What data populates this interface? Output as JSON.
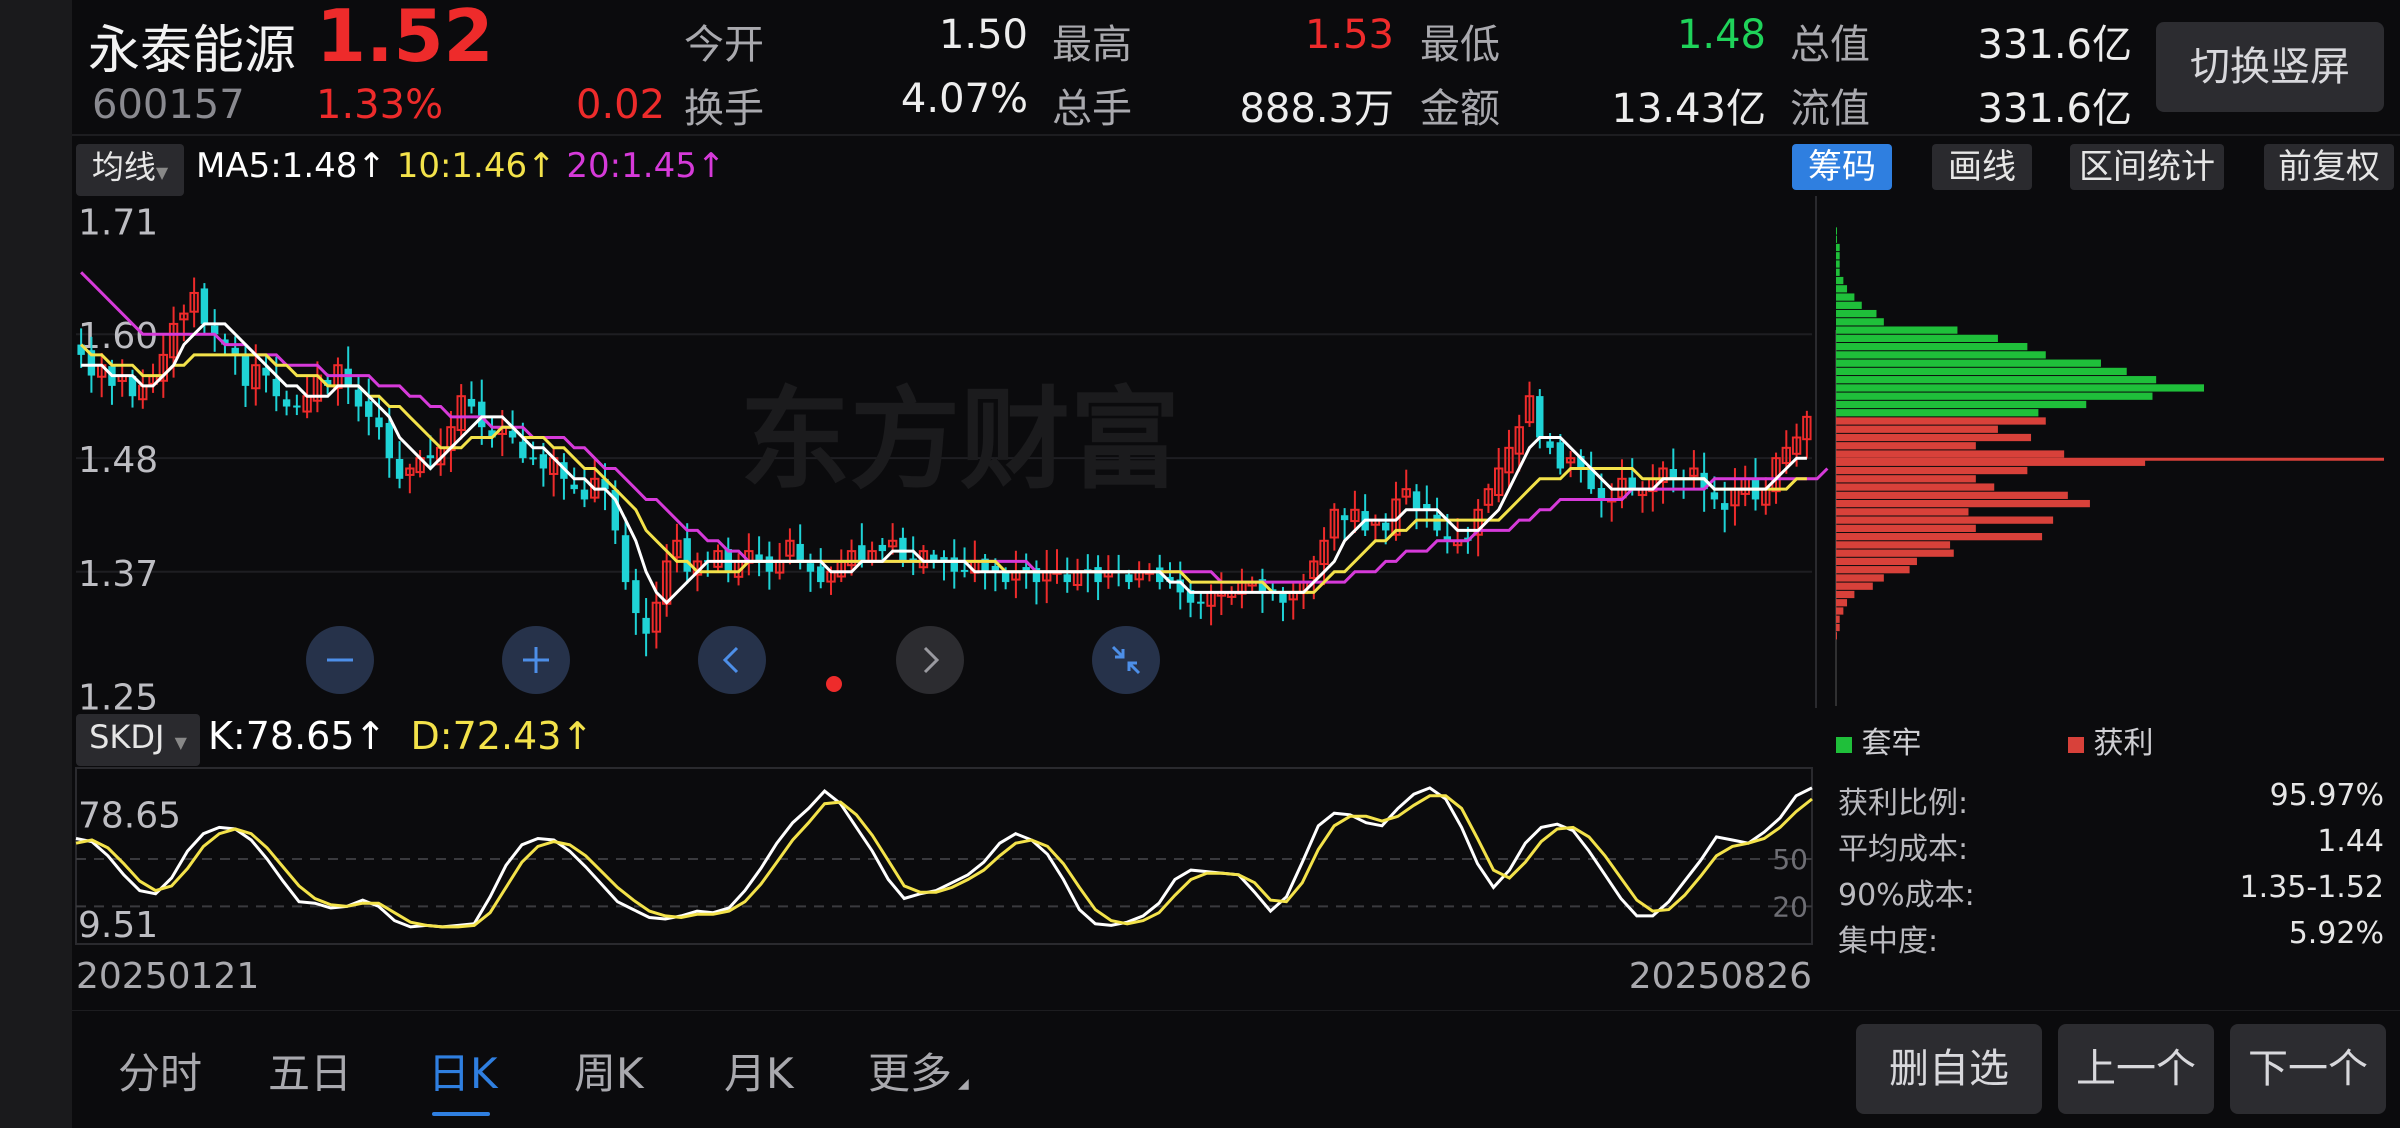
{
  "header": {
    "name": "永泰能源",
    "price": "1.52",
    "code": "600157",
    "change_pct": "1.33%",
    "change": "0.02",
    "stats": [
      {
        "label": "今开",
        "value": "1.50",
        "color": "white"
      },
      {
        "label": "最高",
        "value": "1.53",
        "color": "red"
      },
      {
        "label": "最低",
        "value": "1.48",
        "color": "green"
      },
      {
        "label": "总值",
        "value": "331.6亿",
        "color": "white"
      },
      {
        "label": "换手",
        "value": "4.07%",
        "color": "white"
      },
      {
        "label": "总手",
        "value": "888.3万",
        "color": "white"
      },
      {
        "label": "金额",
        "value": "13.43亿",
        "color": "white"
      },
      {
        "label": "流值",
        "value": "331.6亿",
        "color": "white"
      }
    ],
    "switch_button": "切换竖屏"
  },
  "ma_bar": {
    "selector": "均线",
    "ma5": "MA5:1.48↑",
    "ma10": "10:1.46↑",
    "ma20": "20:1.45↑",
    "buttons": [
      "筹码",
      "画线",
      "区间统计",
      "前复权"
    ]
  },
  "kdj_bar": {
    "selector": "SKDJ",
    "k": "K:78.65↑",
    "d": "D:72.43↑"
  },
  "watermark": "东方财富",
  "colors": {
    "up": "#ee2b2b",
    "down": "#1fd3d6",
    "ma5": "#ffffff",
    "ma10": "#f3e24a",
    "ma20": "#d63ad9",
    "accent": "#2f7fe0",
    "chip_loss": "#1fbf3a",
    "chip_profit": "#d8413a"
  },
  "dates": {
    "start": "20250121",
    "end": "20250826"
  },
  "controls": [
    "zoom-out-icon",
    "zoom-in-icon",
    "chevron-left-icon",
    "chevron-right-icon",
    "collapse-icon"
  ],
  "chip_panel": {
    "legend_loss": "套牢",
    "legend_profit": "获利",
    "stats": [
      {
        "label": "获利比例:",
        "value": "95.97%"
      },
      {
        "label": "平均成本:",
        "value": "1.44"
      },
      {
        "label": "90%成本:",
        "value": "1.35-1.52"
      },
      {
        "label": "集中度:",
        "value": "5.92%"
      }
    ],
    "price_min": 1.24,
    "price_max": 1.73,
    "current_price": 1.52,
    "bars": [
      [
        1.7,
        0.0
      ],
      [
        1.692,
        0.0
      ],
      [
        1.684,
        0.01
      ],
      [
        1.676,
        0.01
      ],
      [
        1.668,
        0.01
      ],
      [
        1.66,
        0.01
      ],
      [
        1.652,
        0.02
      ],
      [
        1.644,
        0.03
      ],
      [
        1.636,
        0.05
      ],
      [
        1.628,
        0.07
      ],
      [
        1.62,
        0.11
      ],
      [
        1.612,
        0.13
      ],
      [
        1.604,
        0.33
      ],
      [
        1.596,
        0.44
      ],
      [
        1.588,
        0.52
      ],
      [
        1.58,
        0.57
      ],
      [
        1.572,
        0.72
      ],
      [
        1.564,
        0.79
      ],
      [
        1.556,
        0.87
      ],
      [
        1.548,
        1.0
      ],
      [
        1.54,
        0.86
      ],
      [
        1.532,
        0.68
      ],
      [
        1.524,
        0.55
      ],
      [
        1.516,
        0.57
      ],
      [
        1.508,
        0.44
      ],
      [
        1.5,
        0.53
      ],
      [
        1.492,
        0.38
      ],
      [
        1.484,
        0.62
      ],
      [
        1.476,
        0.84
      ],
      [
        1.468,
        0.52
      ],
      [
        1.46,
        0.38
      ],
      [
        1.452,
        0.43
      ],
      [
        1.444,
        0.63
      ],
      [
        1.436,
        0.69
      ],
      [
        1.428,
        0.36
      ],
      [
        1.42,
        0.59
      ],
      [
        1.412,
        0.38
      ],
      [
        1.404,
        0.56
      ],
      [
        1.396,
        0.31
      ],
      [
        1.388,
        0.32
      ],
      [
        1.38,
        0.22
      ],
      [
        1.372,
        0.2
      ],
      [
        1.364,
        0.13
      ],
      [
        1.356,
        0.1
      ],
      [
        1.348,
        0.05
      ],
      [
        1.34,
        0.03
      ],
      [
        1.332,
        0.02
      ],
      [
        1.324,
        0.01
      ],
      [
        1.316,
        0.01
      ],
      [
        1.308,
        0.0
      ]
    ]
  },
  "bottom_nav": {
    "tabs": [
      "分时",
      "五日",
      "日K",
      "周K",
      "月K",
      "更多"
    ],
    "active": 2,
    "buttons": [
      "删自选",
      "上一个",
      "下一个"
    ]
  },
  "chart_data": [
    {
      "type": "candlestick",
      "name": "日K",
      "x_start": "20250121",
      "x_end": "20250826",
      "y_ticks": [
        1.71,
        1.6,
        1.48,
        1.37,
        1.25
      ],
      "ylim": [
        1.24,
        1.73
      ],
      "close": [
        1.58,
        1.56,
        1.57,
        1.55,
        1.56,
        1.54,
        1.55,
        1.56,
        1.58,
        1.61,
        1.62,
        1.64,
        1.61,
        1.6,
        1.59,
        1.58,
        1.55,
        1.57,
        1.56,
        1.54,
        1.53,
        1.53,
        1.54,
        1.56,
        1.55,
        1.57,
        1.55,
        1.53,
        1.52,
        1.51,
        1.48,
        1.46,
        1.47,
        1.48,
        1.48,
        1.49,
        1.51,
        1.54,
        1.53,
        1.51,
        1.5,
        1.51,
        1.5,
        1.48,
        1.48,
        1.47,
        1.48,
        1.46,
        1.45,
        1.44,
        1.46,
        1.45,
        1.41,
        1.36,
        1.33,
        1.31,
        1.34,
        1.38,
        1.4,
        1.37,
        1.38,
        1.38,
        1.39,
        1.37,
        1.38,
        1.39,
        1.38,
        1.37,
        1.38,
        1.4,
        1.38,
        1.37,
        1.36,
        1.37,
        1.38,
        1.39,
        1.38,
        1.39,
        1.39,
        1.4,
        1.38,
        1.38,
        1.39,
        1.38,
        1.38,
        1.37,
        1.37,
        1.38,
        1.37,
        1.37,
        1.36,
        1.37,
        1.37,
        1.36,
        1.37,
        1.37,
        1.36,
        1.37,
        1.37,
        1.36,
        1.37,
        1.37,
        1.36,
        1.37,
        1.37,
        1.36,
        1.36,
        1.35,
        1.34,
        1.34,
        1.35,
        1.35,
        1.35,
        1.36,
        1.36,
        1.35,
        1.35,
        1.34,
        1.35,
        1.36,
        1.38,
        1.4,
        1.43,
        1.42,
        1.43,
        1.41,
        1.42,
        1.41,
        1.44,
        1.45,
        1.43,
        1.43,
        1.41,
        1.4,
        1.4,
        1.4,
        1.43,
        1.45,
        1.47,
        1.49,
        1.51,
        1.54,
        1.5,
        1.49,
        1.47,
        1.48,
        1.47,
        1.45,
        1.44,
        1.44,
        1.46,
        1.45,
        1.45,
        1.46,
        1.47,
        1.46,
        1.46,
        1.47,
        1.45,
        1.44,
        1.43,
        1.45,
        1.46,
        1.44,
        1.45,
        1.48,
        1.49,
        1.5,
        1.52
      ],
      "ma5": [
        1.57,
        1.57,
        1.57,
        1.56,
        1.56,
        1.56,
        1.55,
        1.55,
        1.56,
        1.57,
        1.59,
        1.6,
        1.61,
        1.61,
        1.61,
        1.6,
        1.59,
        1.58,
        1.57,
        1.56,
        1.55,
        1.55,
        1.54,
        1.54,
        1.54,
        1.55,
        1.55,
        1.55,
        1.54,
        1.53,
        1.52,
        1.5,
        1.49,
        1.48,
        1.47,
        1.48,
        1.49,
        1.5,
        1.51,
        1.52,
        1.52,
        1.52,
        1.51,
        1.5,
        1.49,
        1.49,
        1.48,
        1.47,
        1.46,
        1.46,
        1.45,
        1.45,
        1.44,
        1.42,
        1.4,
        1.37,
        1.35,
        1.34,
        1.35,
        1.36,
        1.37,
        1.38,
        1.38,
        1.38,
        1.38,
        1.38,
        1.38,
        1.38,
        1.38,
        1.38,
        1.38,
        1.38,
        1.38,
        1.37,
        1.37,
        1.37,
        1.38,
        1.38,
        1.38,
        1.39,
        1.39,
        1.39,
        1.38,
        1.38,
        1.38,
        1.38,
        1.38,
        1.37,
        1.37,
        1.37,
        1.37,
        1.37,
        1.37,
        1.37,
        1.37,
        1.37,
        1.37,
        1.37,
        1.37,
        1.37,
        1.37,
        1.37,
        1.37,
        1.37,
        1.37,
        1.37,
        1.36,
        1.36,
        1.35,
        1.35,
        1.35,
        1.35,
        1.35,
        1.35,
        1.35,
        1.35,
        1.35,
        1.35,
        1.35,
        1.35,
        1.36,
        1.37,
        1.38,
        1.4,
        1.41,
        1.42,
        1.42,
        1.42,
        1.42,
        1.43,
        1.43,
        1.43,
        1.43,
        1.42,
        1.41,
        1.41,
        1.41,
        1.42,
        1.43,
        1.45,
        1.47,
        1.49,
        1.5,
        1.5,
        1.5,
        1.49,
        1.48,
        1.47,
        1.46,
        1.45,
        1.45,
        1.45,
        1.45,
        1.45,
        1.46,
        1.46,
        1.46,
        1.46,
        1.46,
        1.45,
        1.45,
        1.45,
        1.45,
        1.45,
        1.45,
        1.46,
        1.47,
        1.48,
        1.48
      ],
      "ma10": [
        1.59,
        1.58,
        1.58,
        1.57,
        1.57,
        1.57,
        1.56,
        1.56,
        1.56,
        1.57,
        1.57,
        1.58,
        1.58,
        1.58,
        1.58,
        1.58,
        1.58,
        1.58,
        1.58,
        1.57,
        1.57,
        1.56,
        1.56,
        1.56,
        1.55,
        1.55,
        1.55,
        1.55,
        1.54,
        1.54,
        1.53,
        1.53,
        1.52,
        1.51,
        1.5,
        1.49,
        1.49,
        1.49,
        1.5,
        1.5,
        1.5,
        1.51,
        1.51,
        1.5,
        1.5,
        1.5,
        1.49,
        1.49,
        1.48,
        1.47,
        1.47,
        1.46,
        1.45,
        1.44,
        1.43,
        1.41,
        1.4,
        1.39,
        1.38,
        1.38,
        1.37,
        1.37,
        1.37,
        1.37,
        1.37,
        1.38,
        1.38,
        1.38,
        1.38,
        1.38,
        1.38,
        1.38,
        1.38,
        1.38,
        1.38,
        1.38,
        1.38,
        1.38,
        1.38,
        1.38,
        1.38,
        1.38,
        1.38,
        1.38,
        1.38,
        1.38,
        1.38,
        1.38,
        1.38,
        1.38,
        1.37,
        1.37,
        1.37,
        1.37,
        1.37,
        1.37,
        1.37,
        1.37,
        1.37,
        1.37,
        1.37,
        1.37,
        1.37,
        1.37,
        1.37,
        1.37,
        1.37,
        1.37,
        1.36,
        1.36,
        1.36,
        1.36,
        1.36,
        1.36,
        1.36,
        1.36,
        1.35,
        1.35,
        1.35,
        1.35,
        1.35,
        1.36,
        1.37,
        1.37,
        1.38,
        1.39,
        1.4,
        1.4,
        1.41,
        1.41,
        1.42,
        1.42,
        1.42,
        1.42,
        1.42,
        1.42,
        1.42,
        1.42,
        1.42,
        1.43,
        1.44,
        1.45,
        1.46,
        1.46,
        1.46,
        1.47,
        1.47,
        1.47,
        1.47,
        1.47,
        1.47,
        1.47,
        1.46,
        1.46,
        1.46,
        1.46,
        1.46,
        1.46,
        1.46,
        1.45,
        1.45,
        1.45,
        1.45,
        1.45,
        1.45,
        1.45,
        1.45,
        1.46,
        1.46
      ],
      "ma20": [
        1.66,
        1.65,
        1.64,
        1.63,
        1.62,
        1.61,
        1.6,
        1.6,
        1.6,
        1.6,
        1.6,
        1.6,
        1.6,
        1.6,
        1.59,
        1.59,
        1.59,
        1.58,
        1.58,
        1.58,
        1.57,
        1.57,
        1.57,
        1.57,
        1.56,
        1.56,
        1.56,
        1.56,
        1.56,
        1.55,
        1.55,
        1.55,
        1.54,
        1.54,
        1.53,
        1.53,
        1.52,
        1.52,
        1.52,
        1.52,
        1.51,
        1.51,
        1.51,
        1.51,
        1.5,
        1.5,
        1.5,
        1.5,
        1.49,
        1.49,
        1.48,
        1.47,
        1.47,
        1.46,
        1.45,
        1.44,
        1.44,
        1.43,
        1.42,
        1.41,
        1.41,
        1.4,
        1.4,
        1.39,
        1.39,
        1.38,
        1.38,
        1.38,
        1.38,
        1.38,
        1.38,
        1.38,
        1.38,
        1.38,
        1.38,
        1.38,
        1.38,
        1.38,
        1.38,
        1.38,
        1.38,
        1.38,
        1.38,
        1.38,
        1.38,
        1.38,
        1.38,
        1.38,
        1.38,
        1.38,
        1.38,
        1.38,
        1.38,
        1.37,
        1.37,
        1.37,
        1.37,
        1.37,
        1.37,
        1.37,
        1.37,
        1.37,
        1.37,
        1.37,
        1.37,
        1.37,
        1.37,
        1.37,
        1.37,
        1.37,
        1.37,
        1.36,
        1.36,
        1.36,
        1.36,
        1.36,
        1.36,
        1.36,
        1.36,
        1.36,
        1.36,
        1.36,
        1.36,
        1.36,
        1.37,
        1.37,
        1.37,
        1.38,
        1.38,
        1.39,
        1.39,
        1.39,
        1.4,
        1.4,
        1.4,
        1.4,
        1.41,
        1.41,
        1.41,
        1.41,
        1.42,
        1.42,
        1.43,
        1.43,
        1.44,
        1.44,
        1.44,
        1.44,
        1.44,
        1.44,
        1.44,
        1.45,
        1.45,
        1.45,
        1.45,
        1.45,
        1.45,
        1.45,
        1.45,
        1.46,
        1.46,
        1.46,
        1.46,
        1.46,
        1.46,
        1.46,
        1.46,
        1.46,
        1.46,
        1.46,
        1.47
      ]
    },
    {
      "type": "line",
      "name": "SKDJ",
      "y_ticks_left": [
        78.65,
        9.51
      ],
      "y_ticks_right": [
        50,
        20
      ],
      "ylim": [
        0,
        100
      ],
      "series": [
        {
          "name": "K",
          "values": [
            63,
            61,
            52,
            40,
            30,
            28,
            38,
            55,
            66,
            70,
            69,
            62,
            50,
            36,
            23,
            22,
            19,
            20,
            24,
            20,
            11,
            7,
            8,
            7,
            8,
            9,
            26,
            46,
            59,
            63,
            62,
            55,
            45,
            34,
            23,
            18,
            13,
            12,
            14,
            17,
            16,
            19,
            30,
            44,
            60,
            73,
            82,
            93,
            85,
            70,
            55,
            37,
            25,
            28,
            30,
            35,
            40,
            48,
            60,
            66,
            62,
            53,
            37,
            18,
            9,
            8,
            10,
            14,
            22,
            37,
            43,
            42,
            41,
            40,
            29,
            17,
            26,
            48,
            71,
            79,
            78,
            73,
            71,
            82,
            91,
            95,
            88,
            70,
            47,
            32,
            43,
            60,
            70,
            72,
            68,
            55,
            40,
            25,
            14,
            14,
            23,
            36,
            49,
            64,
            62,
            60,
            67,
            76,
            90,
            95
          ]
        },
        {
          "name": "D",
          "values": [
            60,
            62,
            57,
            47,
            36,
            30,
            33,
            44,
            58,
            66,
            69,
            66,
            57,
            45,
            33,
            25,
            21,
            20,
            22,
            22,
            16,
            10,
            8,
            7,
            7,
            8,
            16,
            32,
            48,
            58,
            61,
            59,
            52,
            42,
            32,
            24,
            17,
            14,
            13,
            15,
            15,
            17,
            23,
            34,
            48,
            62,
            73,
            85,
            86,
            78,
            65,
            49,
            33,
            29,
            29,
            32,
            37,
            43,
            52,
            60,
            62,
            58,
            47,
            32,
            18,
            11,
            9,
            11,
            16,
            27,
            37,
            41,
            41,
            40,
            35,
            24,
            23,
            35,
            56,
            71,
            77,
            77,
            74,
            77,
            84,
            90,
            90,
            82,
            63,
            43,
            38,
            48,
            61,
            69,
            70,
            64,
            52,
            38,
            24,
            17,
            18,
            27,
            39,
            52,
            58,
            60,
            63,
            70,
            80,
            88
          ]
        }
      ]
    },
    {
      "type": "bar",
      "name": "筹码分布",
      "orientation": "horizontal",
      "note": "price-volume chip distribution; green = 套牢 (above price), red = 获利 (below price)"
    }
  ]
}
